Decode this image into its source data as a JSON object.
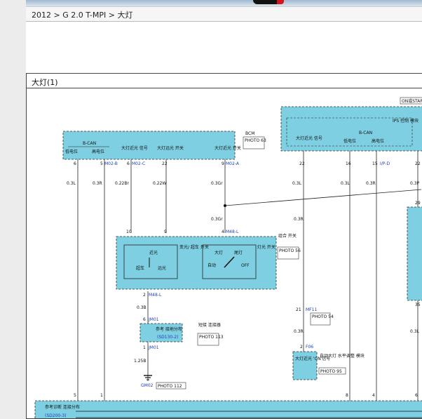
{
  "breadcrumb": "2012 > G 2.0 T-MPI > 大灯",
  "diagram": {
    "title": "大灯(1)",
    "on_start": "ON或START",
    "bcm": {
      "name": "BCM",
      "photo": "PHOTO 63",
      "bcan": "B-CAN",
      "low": "低电位",
      "high": "高电位",
      "low_beam_sig": "大灯近光 信号",
      "high_beam_sw": "大灯远光 开关",
      "low_beam_sw": "大灯近光 开关"
    },
    "ips": {
      "name": "IPS 控制 模块",
      "headlamp_low": "大灯近光 信号",
      "bcan": "B-CAN",
      "low": "低电位",
      "high": "高电位"
    },
    "pins": {
      "p6": "6",
      "p5": "5",
      "m02b": "M02-B",
      "p6b": "6",
      "m02c": "M02-C",
      "p22": "22",
      "p9": "9",
      "m02a": "M02-A",
      "p22b": "22",
      "p16": "16",
      "p15": "15",
      "ipd": "I/P-D",
      "p22c": "22",
      "p10": "10",
      "p9b": "9",
      "p4": "4",
      "m48l": "M48-L",
      "p2": "2",
      "m48l2": "M48-L",
      "p6c": "6",
      "jm01": "JM01",
      "p1": "1",
      "jm01b": "JM01",
      "p21": "21",
      "mf11": "MF11",
      "p2b": "2",
      "f06": "F06",
      "p29": "29",
      "p35": "35",
      "p5b": "5",
      "p1b": "1",
      "p8": "8",
      "p4b": "4",
      "p6d": "6"
    },
    "wires": {
      "w1": "0.3L",
      "w2": "0.3R",
      "w3": "0.22Br",
      "w4": "0.22W",
      "w5": "0.3Gr",
      "w6": "0.3Gr",
      "w7": "0.3L",
      "w8": "0.3L",
      "w9": "0.3R",
      "w10": "0.3P",
      "w11": "0.3R",
      "hid": "HID",
      "w12": "0.3B",
      "w13": "1.25B",
      "w14": "0.3R",
      "w15": "0.3L"
    },
    "combo_switch": {
      "name": "组合 开关",
      "photo": "PHOTO 56",
      "light_sw": "灯光 开关",
      "pass_sw": "变光/ 超车 开关",
      "low": "近光",
      "pass": "超车",
      "high": "远光",
      "head": "大灯",
      "tail": "尾灯",
      "auto": "自动",
      "off": "OFF"
    },
    "splice": {
      "name": "短接 连接器",
      "photo": "PHOTO 113",
      "ref": "参考 接地分布",
      "sd": "(SD130-2)"
    },
    "ground": {
      "id": "GM02",
      "photo": "PHOTO 112"
    },
    "mf11_photo": "PHOTO 54",
    "leveling": {
      "name": "自动大灯 水平调整 模块",
      "sig": "大灯近光 'ON'信号",
      "photo": "PHOTO 95"
    },
    "diag_ref": {
      "label": "参考诊断 连接分布",
      "sd": "(SD200-3)"
    }
  }
}
